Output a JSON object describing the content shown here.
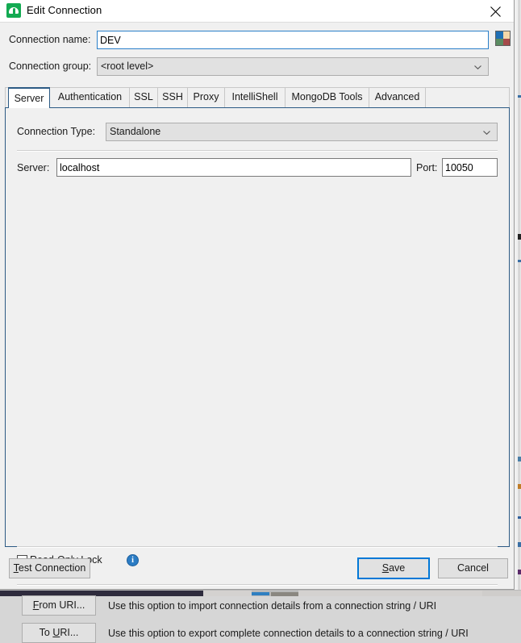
{
  "window": {
    "title": "Edit Connection",
    "app_icon": "mongodb-leaf-icon",
    "close_icon": "close-icon",
    "icon_color": "#13aa52"
  },
  "form": {
    "connection_name": {
      "label": "Connection name:",
      "value": "DEV"
    },
    "connection_group": {
      "label": "Connection group:",
      "value": "<root level>"
    },
    "color_swatch": {
      "name": "color-picker-swatch",
      "colors": [
        "#1f6fb4",
        "#f5d7a8",
        "#5b8c62",
        "#a54a4a"
      ]
    }
  },
  "tabs": [
    {
      "label": "Server",
      "active": true
    },
    {
      "label": "Authentication",
      "active": false
    },
    {
      "label": "SSL",
      "active": false
    },
    {
      "label": "SSH",
      "active": false
    },
    {
      "label": "Proxy",
      "active": false
    },
    {
      "label": "IntelliShell",
      "active": false
    },
    {
      "label": "MongoDB Tools",
      "active": false
    },
    {
      "label": "Advanced",
      "active": false
    }
  ],
  "server_tab": {
    "connection_type": {
      "label": "Connection Type:",
      "value": "Standalone"
    },
    "server": {
      "label": "Server:",
      "value": "localhost"
    },
    "port": {
      "label": "Port:",
      "value": "10050"
    },
    "read_only_lock": {
      "label": "Read-Only Lock",
      "checked": false,
      "info_icon": "info-icon",
      "info_glyph": "i"
    },
    "uri_actions": [
      {
        "button_mnemonic": "F",
        "button_rest": "rom URI...",
        "description": "Use this option to import connection details from a connection string / URI"
      },
      {
        "button_pre": "To ",
        "button_mnemonic": "U",
        "button_rest": "RI...",
        "description": "Use this option to export complete connection details to a connection string / URI"
      }
    ]
  },
  "footer": {
    "test_connection": {
      "mnemonic": "T",
      "rest": "est Connection"
    },
    "save": {
      "pre": "S",
      "mnemonic": "S",
      "rest": "ave",
      "is_default": true
    },
    "cancel": {
      "label": "Cancel"
    }
  },
  "accent": {
    "focus_blue": "#0078d7",
    "panel_border_blue": "#2c5a84",
    "info_blue": "#2b7cc4"
  }
}
